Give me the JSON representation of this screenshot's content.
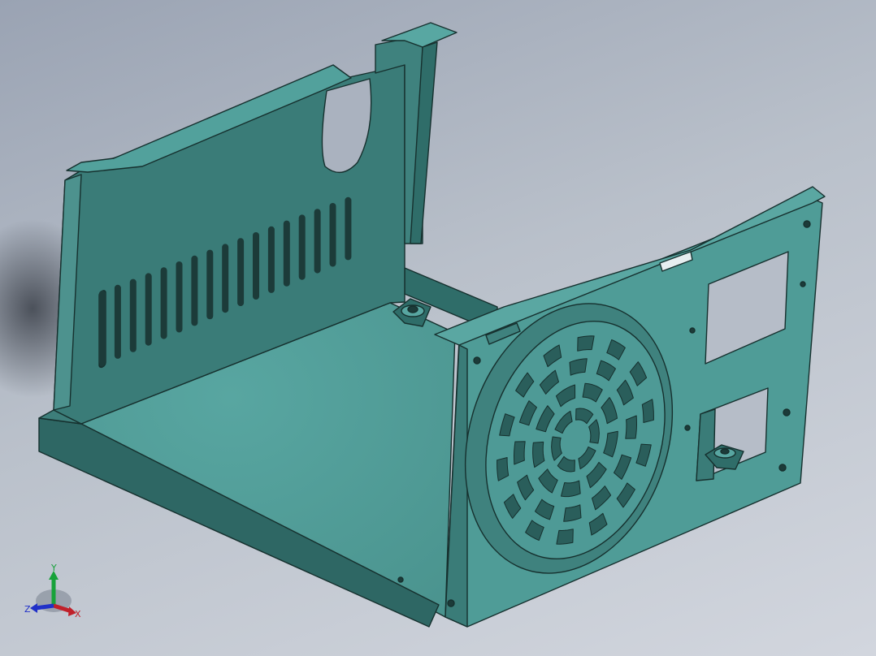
{
  "viewport": {
    "background_top": "#9aa3b3",
    "background_bottom": "#d2d6de"
  },
  "model": {
    "body_color": "#4e9a96",
    "edge_color": "#16302e",
    "shade_color": "#2f6d69",
    "light_color": "#5aa7a2"
  },
  "triad": {
    "x_label": "X",
    "y_label": "Y",
    "z_label": "Z",
    "x_color": "#c0202a",
    "y_color": "#18a23a",
    "z_color": "#2030c8"
  }
}
